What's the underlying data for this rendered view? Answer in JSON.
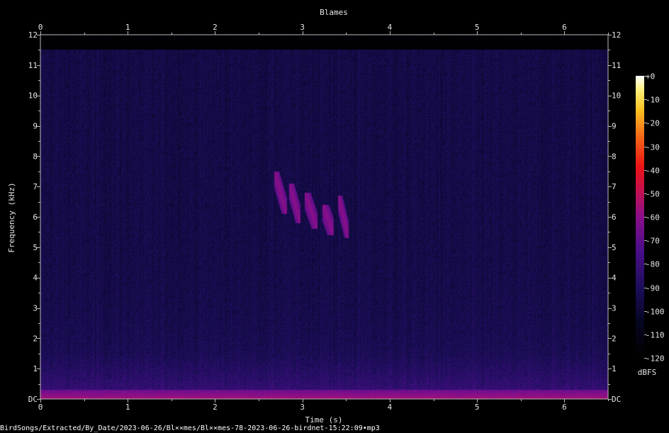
{
  "chart_data": {
    "type": "heatmap",
    "title": "Blames",
    "xlabel": "Time (s)",
    "ylabel": "Frequency (kHz)",
    "xlim": [
      0,
      6.5
    ],
    "ylim": [
      0,
      12
    ],
    "x_ticks": [
      "0",
      "1",
      "2",
      "3",
      "4",
      "5",
      "6"
    ],
    "y_ticks": [
      "DC",
      "1",
      "2",
      "3",
      "4",
      "5",
      "6",
      "7",
      "8",
      "9",
      "10",
      "11",
      "12"
    ],
    "colorbar": {
      "label": "dBFS",
      "range": [
        -120,
        0
      ],
      "ticks": [
        "+0",
        "-10",
        "-20",
        "-30",
        "-40",
        "-50",
        "-60",
        "-70",
        "-80",
        "-90",
        "-100",
        "-110",
        "-120"
      ]
    },
    "noise_floor_db": -95,
    "upper_cutoff_khz": 11.5,
    "bird_call": {
      "time_range_s": [
        2.65,
        3.55
      ],
      "freq_range_khz": [
        5.2,
        7.6
      ],
      "peak_db": -60,
      "notes": [
        {
          "t0": 2.68,
          "t1": 2.82,
          "f_top": 7.5,
          "f_bot": 6.1
        },
        {
          "t0": 2.85,
          "t1": 2.98,
          "f_top": 7.1,
          "f_bot": 5.8
        },
        {
          "t0": 3.03,
          "t1": 3.17,
          "f_top": 6.8,
          "f_bot": 5.6
        },
        {
          "t0": 3.23,
          "t1": 3.36,
          "f_top": 6.4,
          "f_bot": 5.4
        },
        {
          "t0": 3.41,
          "t1": 3.53,
          "f_top": 6.7,
          "f_bot": 5.3
        }
      ]
    },
    "low_frequency_band": {
      "freq_range_khz": [
        0,
        0.3
      ],
      "peak_db": -55
    }
  },
  "footer": {
    "file_path": "BirdSongs/Extracted/By_Date/2023-06-26/Bl××mes/Bl××mes-78-2023-06-26-birdnet-15:22:09•mp3"
  }
}
